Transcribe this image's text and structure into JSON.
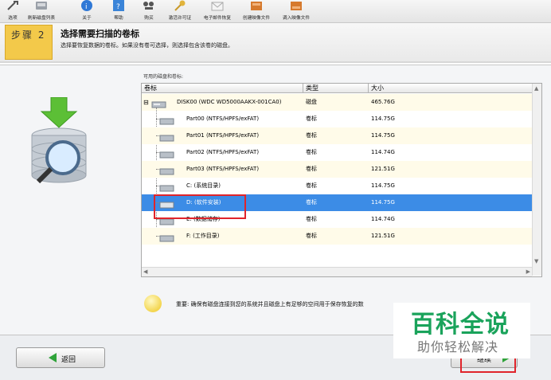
{
  "toolbar": {
    "items": [
      {
        "label": "选项",
        "icon": "wrench-icon"
      },
      {
        "label": "刷新磁盘列表",
        "icon": "refresh-icon"
      },
      {
        "label": "关于",
        "icon": "info-icon"
      },
      {
        "label": "帮助",
        "icon": "help-icon"
      },
      {
        "label": "购买",
        "icon": "cart-icon"
      },
      {
        "label": "激活许可证",
        "icon": "key-icon"
      },
      {
        "label": "电子邮件恢复",
        "icon": "email-icon"
      },
      {
        "label": "创建映像文件",
        "icon": "disk-image-icon"
      },
      {
        "label": "调入映像文件",
        "icon": "load-image-icon"
      }
    ]
  },
  "step": {
    "badge": "步骤 2",
    "title": "选择需要扫描的卷标",
    "subtitle": "选择要恢复数据的卷标。如果没有卷可选择，则选择包含该卷的磁盘。"
  },
  "list": {
    "caption": "可用的磁盘和卷标:",
    "headers": {
      "name": "卷标",
      "type": "类型",
      "size": "大小"
    },
    "root": {
      "name": "DISK00 (WDC WD5000AAKX-001CA0)",
      "type": "磁盘",
      "size": "465.76G"
    },
    "rows": [
      {
        "name": "Part00 (NTFS/HPFS/exFAT)",
        "type": "卷标",
        "size": "114.75G"
      },
      {
        "name": "Part01 (NTFS/HPFS/exFAT)",
        "type": "卷标",
        "size": "114.75G"
      },
      {
        "name": "Part02 (NTFS/HPFS/exFAT)",
        "type": "卷标",
        "size": "114.74G"
      },
      {
        "name": "Part03 (NTFS/HPFS/exFAT)",
        "type": "卷标",
        "size": "121.51G"
      },
      {
        "name": "C: (系统目录)",
        "type": "卷标",
        "size": "114.75G"
      },
      {
        "name": "D: (软件安装)",
        "type": "卷标",
        "size": "114.75G"
      },
      {
        "name": "E: (数据储存)",
        "type": "卷标",
        "size": "114.74G"
      },
      {
        "name": "F: (工作目录)",
        "type": "卷标",
        "size": "121.51G"
      }
    ],
    "selected_index": 5
  },
  "notice": {
    "text": "重要: 确保有磁盘连接到您的系统并且磁盘上有足够的空间用于保存恢复的数"
  },
  "watermark": {
    "title": "百科全说",
    "subtitle": "助你轻松解决"
  },
  "footer": {
    "back_label": "返回",
    "next_label": "继续"
  },
  "colors": {
    "accent": "#f3c94a",
    "selection": "#3c8ce6",
    "highlight": "#e0242b",
    "watermark": "#1aa35b"
  }
}
